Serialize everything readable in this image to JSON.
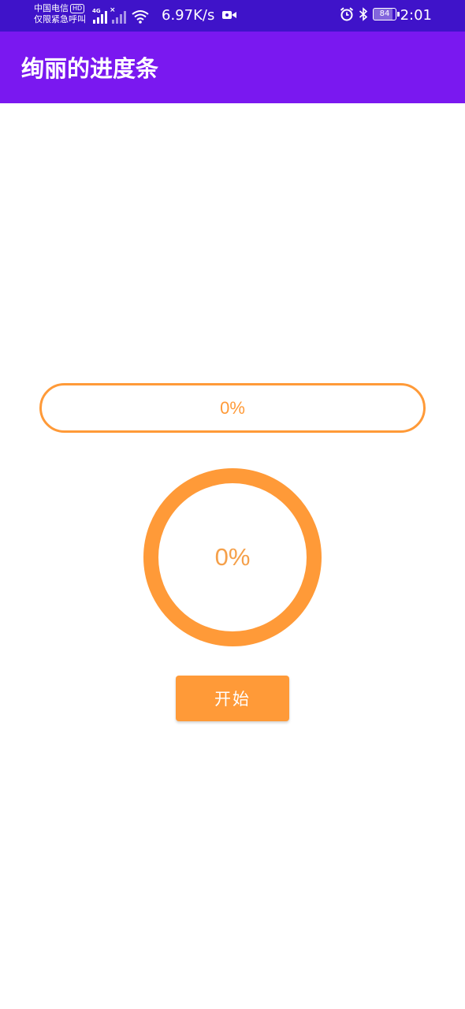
{
  "status_bar": {
    "carrier_line1": "中国电信",
    "hd_badge": "HD",
    "carrier_line2": "仅限紧急呼叫",
    "network_type": "4G",
    "net_speed": "6.97K/s",
    "battery_level": "84",
    "battery_fraction": 0.84,
    "time": "2:01",
    "icons": [
      "signal-icon",
      "signal-icon",
      "wifi-icon",
      "video-icon",
      "alarm-icon",
      "bluetooth-icon",
      "battery-icon"
    ]
  },
  "app_bar": {
    "title": "绚丽的进度条"
  },
  "linear_progress": {
    "value": 0,
    "label": "0%"
  },
  "circular_progress": {
    "value": 0,
    "label": "0%"
  },
  "start_button": {
    "label": "开始"
  },
  "colors": {
    "status_bar": "#3f13c9",
    "app_bar": "#7a18f0",
    "accent": "#ff9a38"
  }
}
